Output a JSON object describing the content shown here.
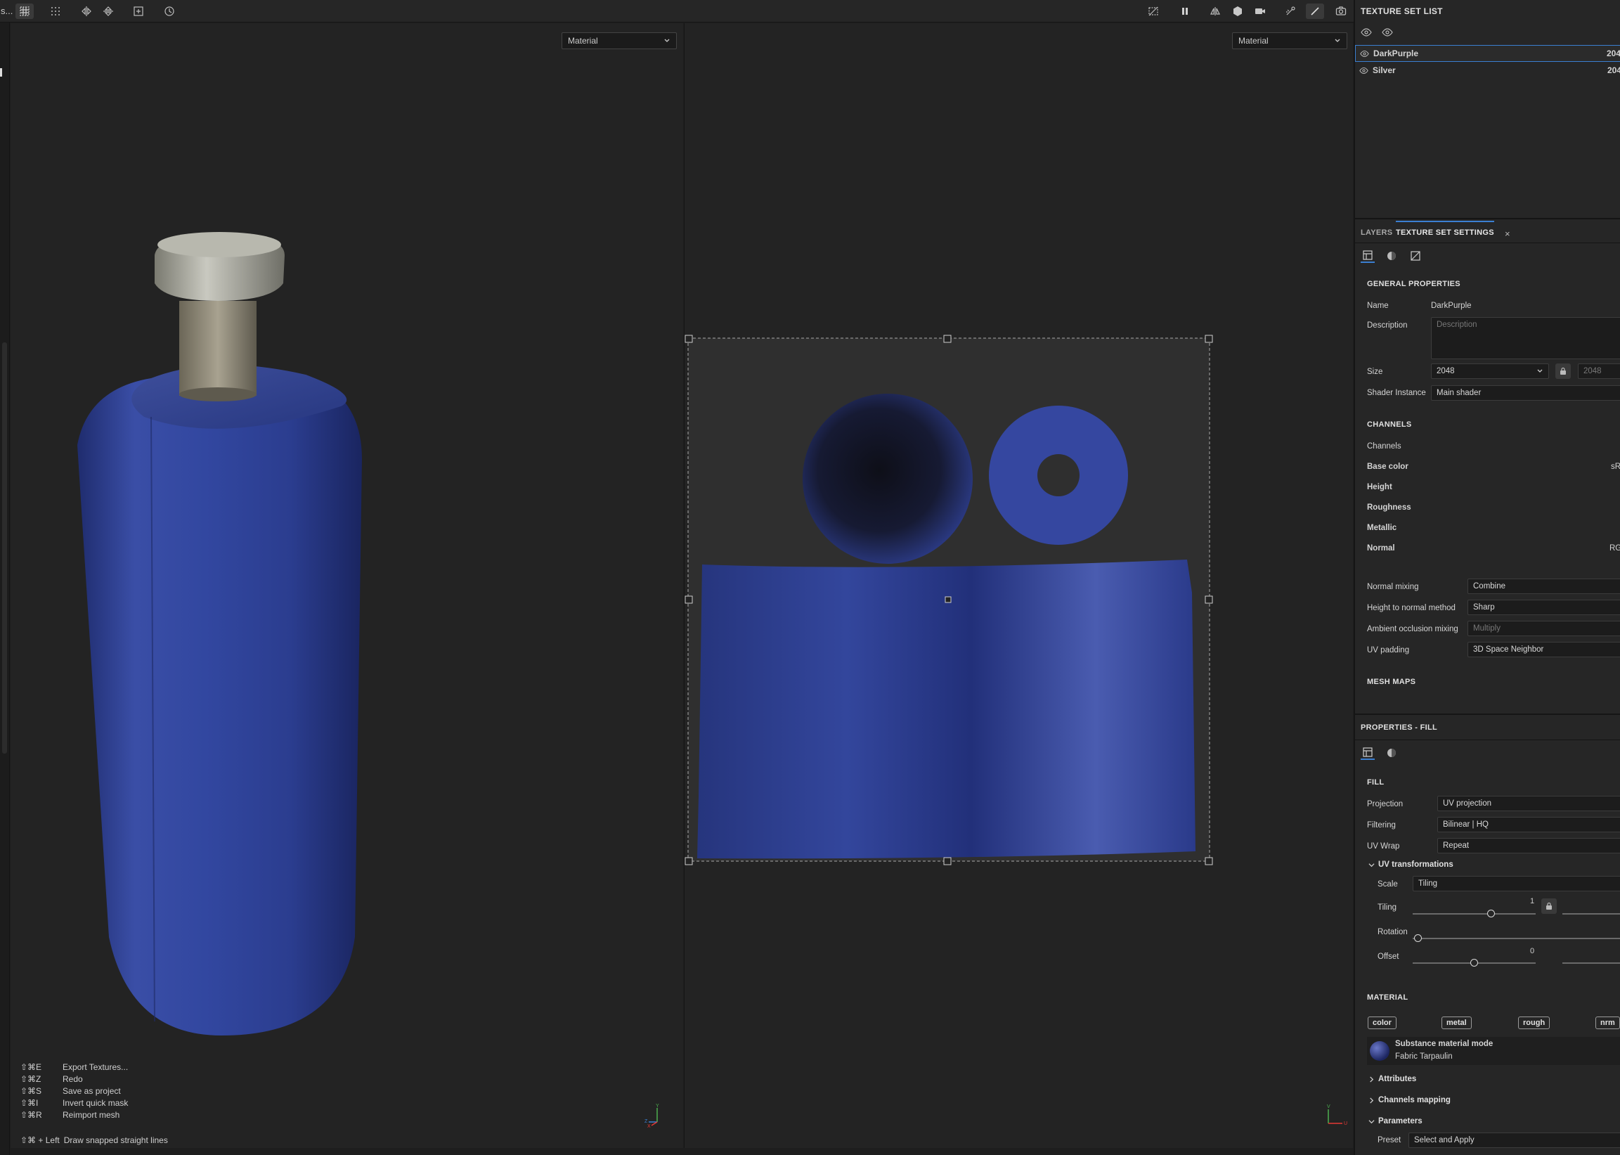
{
  "app": {
    "truncated_title": "s..."
  },
  "viewports": {
    "left_mode": "Material",
    "right_mode": "Material"
  },
  "shortcuts": [
    {
      "key": "⇧⌘E",
      "action": "Export Textures..."
    },
    {
      "key": "⇧⌘Z",
      "action": "Redo"
    },
    {
      "key": "⇧⌘S",
      "action": "Save as project"
    },
    {
      "key": "⇧⌘I",
      "action": "Invert quick mask"
    },
    {
      "key": "⇧⌘R",
      "action": "Reimport mesh"
    }
  ],
  "hint": {
    "key": "⇧⌘ + Left",
    "action": "Draw snapped straight lines"
  },
  "axes_3d": {
    "y": "Y",
    "z": "Z",
    "x": "X"
  },
  "axes_uv": {
    "v": "V",
    "u": "U"
  },
  "texture_set_list": {
    "title": "TEXTURE SET LIST",
    "items": [
      {
        "name": "DarkPurple",
        "res": "204",
        "selected": true
      },
      {
        "name": "Silver",
        "res": "204",
        "selected": false
      }
    ]
  },
  "tabs": {
    "layers": "LAYERS",
    "settings": "TEXTURE SET SETTINGS",
    "close": "×"
  },
  "general": {
    "title": "GENERAL PROPERTIES",
    "name_label": "Name",
    "name_value": "DarkPurple",
    "description_label": "Description",
    "description_placeholder": "Description",
    "size_label": "Size",
    "size_value": "2048",
    "size_value_locked": "2048",
    "shader_label": "Shader Instance",
    "shader_value": "Main shader"
  },
  "channels": {
    "title": "CHANNELS",
    "header": "Channels",
    "items": [
      {
        "name": "Base color",
        "format": "sR"
      },
      {
        "name": "Height",
        "format": ""
      },
      {
        "name": "Roughness",
        "format": ""
      },
      {
        "name": "Metallic",
        "format": ""
      },
      {
        "name": "Normal",
        "format": "RG"
      }
    ],
    "normal_mixing_label": "Normal mixing",
    "normal_mixing_value": "Combine",
    "h2n_label": "Height to normal method",
    "h2n_value": "Sharp",
    "ao_label": "Ambient occlusion mixing",
    "ao_value": "Multiply",
    "uvpad_label": "UV padding",
    "uvpad_value": "3D Space Neighbor"
  },
  "mesh_maps": {
    "title": "MESH MAPS"
  },
  "properties": {
    "title": "PROPERTIES - FILL",
    "fill_title": "FILL",
    "projection_label": "Projection",
    "projection_value": "UV projection",
    "filtering_label": "Filtering",
    "filtering_value": "Bilinear | HQ",
    "uvwrap_label": "UV Wrap",
    "uvwrap_value": "Repeat",
    "uvtrans_label": "UV transformations",
    "scale_label": "Scale",
    "scale_value": "Tiling",
    "tiling_label": "Tiling",
    "tiling_value": "1",
    "rotation_label": "Rotation",
    "offset_label": "Offset",
    "offset_value": "0",
    "material_title": "MATERIAL",
    "chips": [
      "color",
      "metal",
      "rough",
      "nrm"
    ],
    "mat_mode": "Substance material mode",
    "mat_name": "Fabric Tarpaulin",
    "attributes": "Attributes",
    "channels_mapping": "Channels mapping",
    "parameters": "Parameters",
    "preset_label": "Preset",
    "preset_value": "Select and Apply"
  },
  "colors": {
    "accent": "#3b7fd1",
    "bg": "#232323",
    "panel": "#262626",
    "fabric": "#2d3f96"
  }
}
